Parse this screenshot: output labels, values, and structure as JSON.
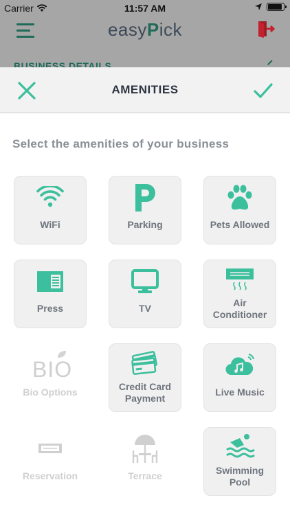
{
  "status_bar": {
    "carrier": "Carrier",
    "time": "11:57 AM"
  },
  "app_header": {
    "brand_prefix": "easy",
    "brand_pin": "P",
    "brand_suffix": "ick",
    "behind_section_title": "BUSINESS DETAILS"
  },
  "modal": {
    "title": "AMENITIES",
    "instructions": "Select the amenities of your business"
  },
  "amenities": [
    {
      "label": "WiFi",
      "icon": "wifi-icon",
      "enabled": true
    },
    {
      "label": "Parking",
      "icon": "parking-icon",
      "enabled": true
    },
    {
      "label": "Pets Allowed",
      "icon": "paw-icon",
      "enabled": true
    },
    {
      "label": "Press",
      "icon": "newspaper-icon",
      "enabled": true
    },
    {
      "label": "TV",
      "icon": "tv-icon",
      "enabled": true
    },
    {
      "label": "Air Conditioner",
      "icon": "air-conditioner-icon",
      "enabled": true
    },
    {
      "label": "Bio Options",
      "icon": "bio-leaf-icon",
      "enabled": false,
      "icon_text": "BIO"
    },
    {
      "label": "Credit Card Payment",
      "icon": "credit-card-icon",
      "enabled": true
    },
    {
      "label": "Live Music",
      "icon": "cloud-music-icon",
      "enabled": true
    },
    {
      "label": "Reservation",
      "icon": "reservation-ticket-icon",
      "enabled": false
    },
    {
      "label": "Terrace",
      "icon": "terrace-umbrella-icon",
      "enabled": false
    },
    {
      "label": "Swimming Pool",
      "icon": "swimmer-icon",
      "enabled": true
    }
  ],
  "colors": {
    "accent": "#3bbf9c",
    "accent_dark": "#1f6a59",
    "disabled": "#cfcfcf",
    "dim_overlay": "#a6a6a6",
    "exit_red": "#c4212e"
  }
}
